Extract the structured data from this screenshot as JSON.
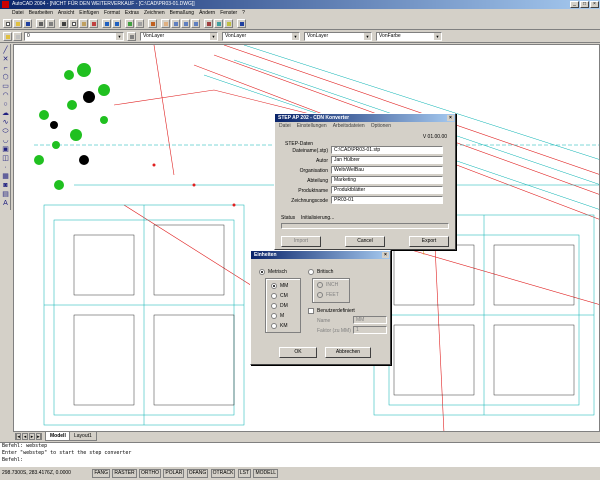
{
  "window": {
    "title": "AutoCAD 2004 - [NICHT FÜR DEN WEITERVERKAUF - [C:\\CAD\\PR03-01.DWG]]",
    "buttons": [
      "_",
      "□",
      "×"
    ]
  },
  "menubar": {
    "items": [
      "Datei",
      "Bearbeiten",
      "Ansicht",
      "Einfügen",
      "Format",
      "Extras",
      "Zeichnen",
      "Bemaßung",
      "Ändern",
      "Fenster",
      "?"
    ]
  },
  "toolbar2": {
    "layer_combo": "0",
    "color_combo": "VonLayer",
    "linetype_combo": "VonLayer",
    "lineweight_combo": "VonLayer",
    "plotstyle_combo": "VonFarbe"
  },
  "tabs": {
    "items": [
      "Modell",
      "Layout1"
    ]
  },
  "command_line": {
    "lines": [
      "Befehl: webstep",
      "Enter \"webstep\" to start the step converter",
      "Befehl:"
    ]
  },
  "status_bar": {
    "coords": "298.7300S, 283.4176Z, 0.0000",
    "toggles": [
      "FANG",
      "RASTER",
      "ORTHO",
      "POLAR",
      "OFANG",
      "OTRACK",
      "LST",
      "MODELL"
    ]
  },
  "step_dialog": {
    "title": "STEP AP 202 - CDN Konverter",
    "menu": [
      "Datei",
      "Einstellungen",
      "Arbeitsdateien",
      "Optionen"
    ],
    "version": "V 01.00.00",
    "section_label": "STEP-Daten",
    "fields": [
      {
        "label": "Dateiname(.stp)",
        "value": "C:\\CAD\\PR03-01.stp"
      },
      {
        "label": "Autor",
        "value": "Jan Hülbrer"
      },
      {
        "label": "Organisation",
        "value": "WeltvWelBau"
      },
      {
        "label": "Abteilung",
        "value": "Marketing"
      },
      {
        "label": "Produktname",
        "value": "Produktblätter"
      },
      {
        "label": "Zeichnungscode",
        "value": "PR03-01"
      }
    ],
    "status_label": "Status",
    "status_value": "Initialisierung...",
    "buttons": {
      "import": "Import",
      "cancel": "Cancel",
      "export": "Export"
    }
  },
  "einheiten_dialog": {
    "title": "Einheiten",
    "metrisch_label": "Metrisch",
    "britisch_label": "Britisch",
    "metric_units": [
      "MM",
      "CM",
      "DM",
      "M",
      "KM"
    ],
    "imperial_units": [
      "INCH",
      "FEET"
    ],
    "custom_label": "Benutzerdefiniert",
    "name_label": "Name",
    "name_value": "MM",
    "factor_label": "Faktor (zu MM)",
    "factor_value": "1",
    "buttons": {
      "ok": "OK",
      "cancel": "Abbrechen"
    }
  }
}
